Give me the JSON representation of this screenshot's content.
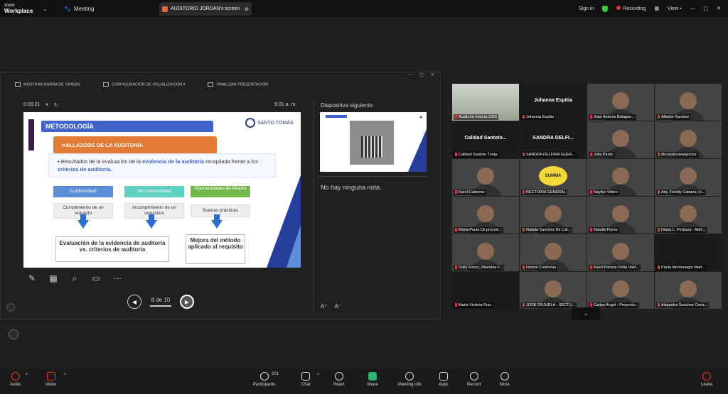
{
  "titlebar": {
    "app_small": "zoom",
    "app_name": "Workplace",
    "meeting": "Meeting",
    "tab": "AUDITORIO JORDAN's screen",
    "sign_in": "Sign in",
    "recording": "Recording",
    "view": "View"
  },
  "presenter": {
    "toolbar": [
      "MOSTRAR BARRA DE TAREAS",
      "CONFIGURACIÓN DE VISUALIZACIÓN ▾",
      "FINALIZAR PRESENTACIÓN"
    ],
    "timer": "0:09:21",
    "clock": "9:01 a. m.",
    "next_label": "Diapositiva siguiente",
    "no_notes": "No hay ninguna nota.",
    "page": "8 de 10"
  },
  "slide": {
    "title": "METODOLOGÍA",
    "seal": "SANTO TOMÁS",
    "section": "HALLAZGOS DE LA AUDITORÍA",
    "bullet_pre": "Resultados de la evaluación de la ",
    "bullet_b1": "evidencia de la auditoría",
    "bullet_mid": " recopilada frente a los ",
    "bullet_b2": "criterios de auditoría.",
    "cat1": "Conformidad",
    "cat2": "No Conformidad",
    "cat3": "Oportunidades de Mejora",
    "sub1": "Cumplimiento de un requisito",
    "sub2": "Incumplimiento de un requisitos",
    "sub3": "Buenas prácticas",
    "res1": "Evaluación de la evidencia de auditoría vs. criterios de auditoría",
    "res2": "Mejora del método aplicado al requisito"
  },
  "gallery": [
    {
      "name": "Auditoria Interna 2025",
      "big": "",
      "kind": "room"
    },
    {
      "name": "Johanna Espitia",
      "big": "Johanna Espitia",
      "kind": "dark"
    },
    {
      "name": "Jose Antonio Balague...",
      "big": "",
      "kind": "person"
    },
    {
      "name": "Alberto Ramirez",
      "big": "",
      "kind": "person"
    },
    {
      "name": "Calidad Santoto Tunja",
      "big": "Calidad Santoto...",
      "kind": "dark"
    },
    {
      "name": "SANDRA DELFINA GUER...",
      "big": "SANDRA DELFI...",
      "kind": "dark"
    },
    {
      "name": "Julia Pardo",
      "big": "",
      "kind": "person"
    },
    {
      "name": "decanaturanegocios",
      "big": "",
      "kind": "person"
    },
    {
      "name": "Karol Gutierrez",
      "big": "",
      "kind": "person"
    },
    {
      "name": "RECTORÍA GENERAL",
      "big": "",
      "kind": "summa"
    },
    {
      "name": "Nayibe Villero",
      "big": "",
      "kind": "person"
    },
    {
      "name": "Arq. Freddy Cabana (U...",
      "big": "",
      "kind": "person"
    },
    {
      "name": "Maria Paula Dir.proced...",
      "big": "",
      "kind": "person"
    },
    {
      "name": "Natalia Sanchez Dir Cal...",
      "big": "",
      "kind": "person"
    },
    {
      "name": "Natalia Florez",
      "big": "",
      "kind": "person"
    },
    {
      "name": "Diana L. Pedraza - Adm...",
      "big": "",
      "kind": "person"
    },
    {
      "name": "Dolly Florez_Maestria F...",
      "big": "",
      "kind": "person"
    },
    {
      "name": "Ivonne Contreras",
      "big": "",
      "kind": "person"
    },
    {
      "name": "Karol Patricia Peña Vald...",
      "big": "",
      "kind": "person"
    },
    {
      "name": "Paola Montenegro Mart...",
      "big": "",
      "kind": "dark"
    },
    {
      "name": "Maria Victoria Ruiz",
      "big": "",
      "kind": "dark"
    },
    {
      "name": "JOSE ORJUELA - SECTU...",
      "big": "",
      "kind": "person"
    },
    {
      "name": "Carlos Angel - Proyecto...",
      "big": "",
      "kind": "person"
    },
    {
      "name": "Alejandra Sanchez Gonz...",
      "big": "",
      "kind": "person"
    }
  ],
  "bottombar": {
    "audio": "Audio",
    "video": "Video",
    "participants": "Participants",
    "participants_count": "201",
    "chat": "Chat",
    "react": "React",
    "share": "Share",
    "meeting_info": "Meeting info",
    "apps": "Apps",
    "record": "Record",
    "more": "More",
    "leave": "Leave"
  }
}
